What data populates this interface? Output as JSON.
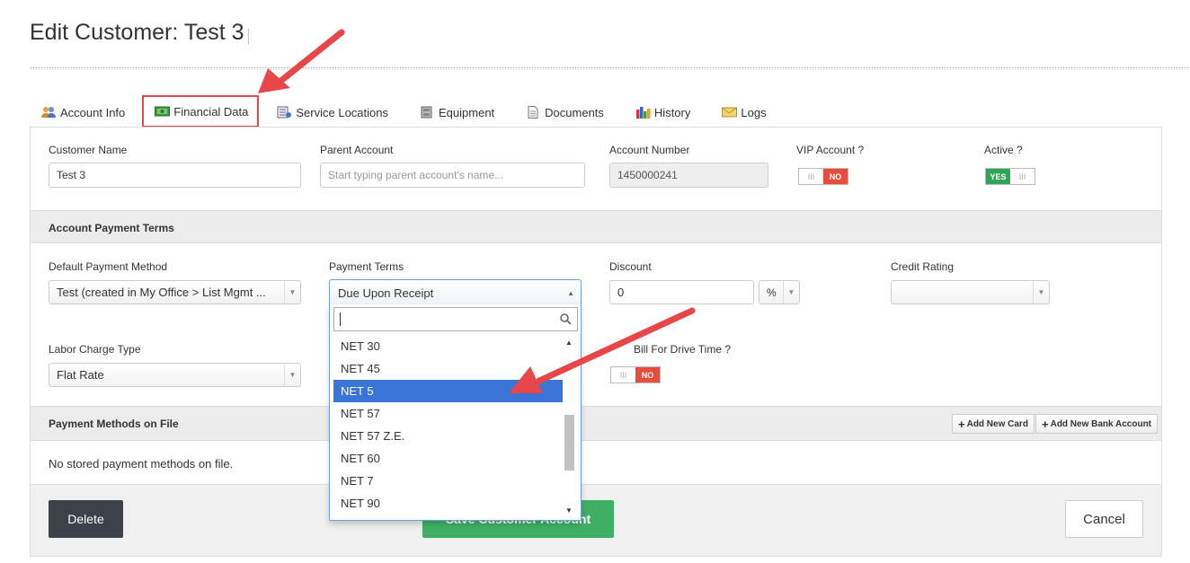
{
  "page": {
    "title": "Edit Customer: Test 3"
  },
  "tabs": [
    {
      "label": "Account Info",
      "icon": "users-icon"
    },
    {
      "label": "Financial Data",
      "icon": "money-icon",
      "active": true
    },
    {
      "label": "Service Locations",
      "icon": "location-list-icon"
    },
    {
      "label": "Equipment",
      "icon": "equipment-icon"
    },
    {
      "label": "Documents",
      "icon": "document-icon"
    },
    {
      "label": "History",
      "icon": "bar-chart-icon"
    },
    {
      "label": "Logs",
      "icon": "envelope-icon"
    }
  ],
  "customer": {
    "name_label": "Customer Name",
    "name_value": "Test 3",
    "parent_label": "Parent Account",
    "parent_placeholder": "Start typing parent account's name...",
    "account_number_label": "Account Number",
    "account_number_value": "1450000241",
    "vip_label": "VIP Account ?",
    "vip_off": "III",
    "vip_value": "NO",
    "active_label": "Active ?",
    "active_value": "YES",
    "active_off": "III"
  },
  "payment_terms_section": {
    "title": "Account Payment Terms",
    "default_method_label": "Default Payment Method",
    "default_method_value": "Test (created in My Office > List Mgmt ...",
    "payment_terms_label": "Payment Terms",
    "payment_terms_value": "Due Upon Receipt",
    "discount_label": "Discount",
    "discount_value": "0",
    "discount_unit": "%",
    "credit_rating_label": "Credit Rating",
    "credit_rating_value": "",
    "labor_label": "Labor Charge Type",
    "labor_value": "Flat Rate",
    "drive_label": "Bill For Drive Time ?",
    "drive_off": "III",
    "drive_value": "NO"
  },
  "dropdown": {
    "options": [
      "NET 30",
      "NET 45",
      "NET 5",
      "NET 57",
      "NET 57 Z.E.",
      "NET 60",
      "NET 7",
      "NET 90"
    ],
    "highlighted": "NET 5"
  },
  "payment_methods": {
    "title": "Payment Methods on File",
    "add_card": "Add New Card",
    "add_bank": "Add New Bank Account",
    "empty_text": "No stored payment methods on file."
  },
  "actions": {
    "delete": "Delete",
    "save": "Save Customer Account",
    "cancel": "Cancel"
  },
  "colors": {
    "annotation_red": "#e8474a",
    "highlight_blue": "#3875d7",
    "save_green": "#3eb065"
  }
}
